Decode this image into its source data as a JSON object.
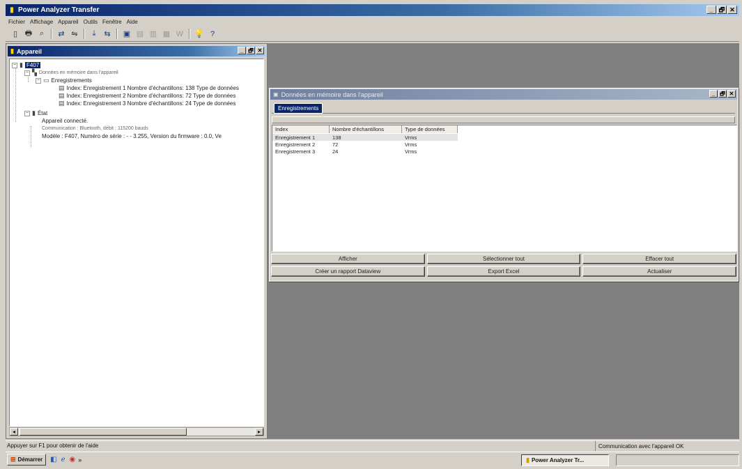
{
  "app": {
    "title": "Power Analyzer Transfer",
    "window_buttons": [
      "_",
      "🗗",
      "✕"
    ]
  },
  "menu": [
    "Fichier",
    "Affichage",
    "Appareil",
    "Outils",
    "Fenêtre",
    "Aide"
  ],
  "toolbar_icons": [
    "new-icon",
    "print-icon",
    "print-preview-icon",
    "connect-icon",
    "disconnect-icon",
    "download-icon",
    "transfer-icon",
    "device-icon",
    "record-icon",
    "report-icon",
    "excel-icon",
    "options-icon",
    "info-icon",
    "help-icon"
  ],
  "appareil_window": {
    "title": "Appareil",
    "tree": {
      "root": "F407",
      "memory_node": "Données en mémoire dans l'appareil",
      "records_folder": "Enregistrements",
      "records": [
        "Index: Enregistrement 1 Nombre d'échantillons: 138 Type de données",
        "Index: Enregistrement 2 Nombre d'échantillons: 72 Type de données",
        "Index: Enregistrement 3 Nombre d'échantillons: 24 Type de données"
      ],
      "state_node": "État",
      "connected": "Appareil connecté.",
      "communication": "Communication : Bluetooth, débit : 115200 bauds",
      "model": "Modèle : F407, Numéro de série : - - 3.255, Version du firmware : 0.0, Ve"
    }
  },
  "data_window": {
    "title": "Données en mémoire dans l'appareil",
    "tab": "Enregistrements",
    "columns": [
      "Index",
      "Nombre d'échantillons",
      "Type de données"
    ],
    "rows": [
      [
        "Enregistrement 1",
        "138",
        "Vrms"
      ],
      [
        "Enregistrement 2",
        "72",
        "Vrms"
      ],
      [
        "Enregistrement 3",
        "24",
        "Vrms"
      ]
    ],
    "buttons_row1": [
      "Afficher",
      "Sélectionner tout",
      "Effacer tout"
    ],
    "buttons_row2": [
      "Créer un rapport Dataview",
      "Export Excel",
      "Actualiser"
    ]
  },
  "status": {
    "left": "Appuyer sur F1 pour obtenir de l'aide",
    "right": "Communication avec l'appareil OK"
  },
  "taskbar": {
    "start": "Démarrer",
    "app_button": "Power Analyzer Tr..."
  }
}
